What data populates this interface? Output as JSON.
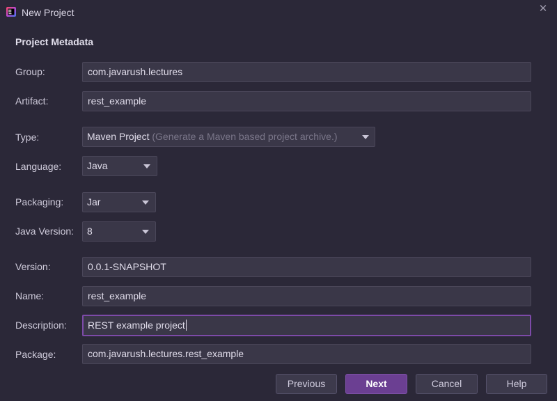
{
  "window": {
    "title": "New Project",
    "close_symbol": "✕",
    "icons": {
      "app": "intellij-logo-icon",
      "close": "close-icon"
    }
  },
  "section": {
    "title": "Project Metadata"
  },
  "fields": {
    "group": {
      "label": "Group:",
      "value": "com.javarush.lectures"
    },
    "artifact": {
      "label": "Artifact:",
      "value": "rest_example"
    },
    "type": {
      "label": "Type:",
      "value": "Maven Project",
      "hint": "(Generate a Maven based project archive.)"
    },
    "language": {
      "label": "Language:",
      "value": "Java"
    },
    "packaging": {
      "label": "Packaging:",
      "value": "Jar"
    },
    "java_version": {
      "label": "Java Version:",
      "value": "8"
    },
    "version": {
      "label": "Version:",
      "value": "0.0.1-SNAPSHOT"
    },
    "name": {
      "label": "Name:",
      "value": "rest_example"
    },
    "description": {
      "label": "Description:",
      "value": "REST example project"
    },
    "package": {
      "label": "Package:",
      "value": "com.javarush.lectures.rest_example"
    }
  },
  "buttons": {
    "previous": "Previous",
    "next": "Next",
    "cancel": "Cancel",
    "help": "Help"
  },
  "colors": {
    "background": "#2b2838",
    "field_background": "#3a3748",
    "focus_border": "#7d4aa8",
    "primary_button": "#6b3f92"
  }
}
